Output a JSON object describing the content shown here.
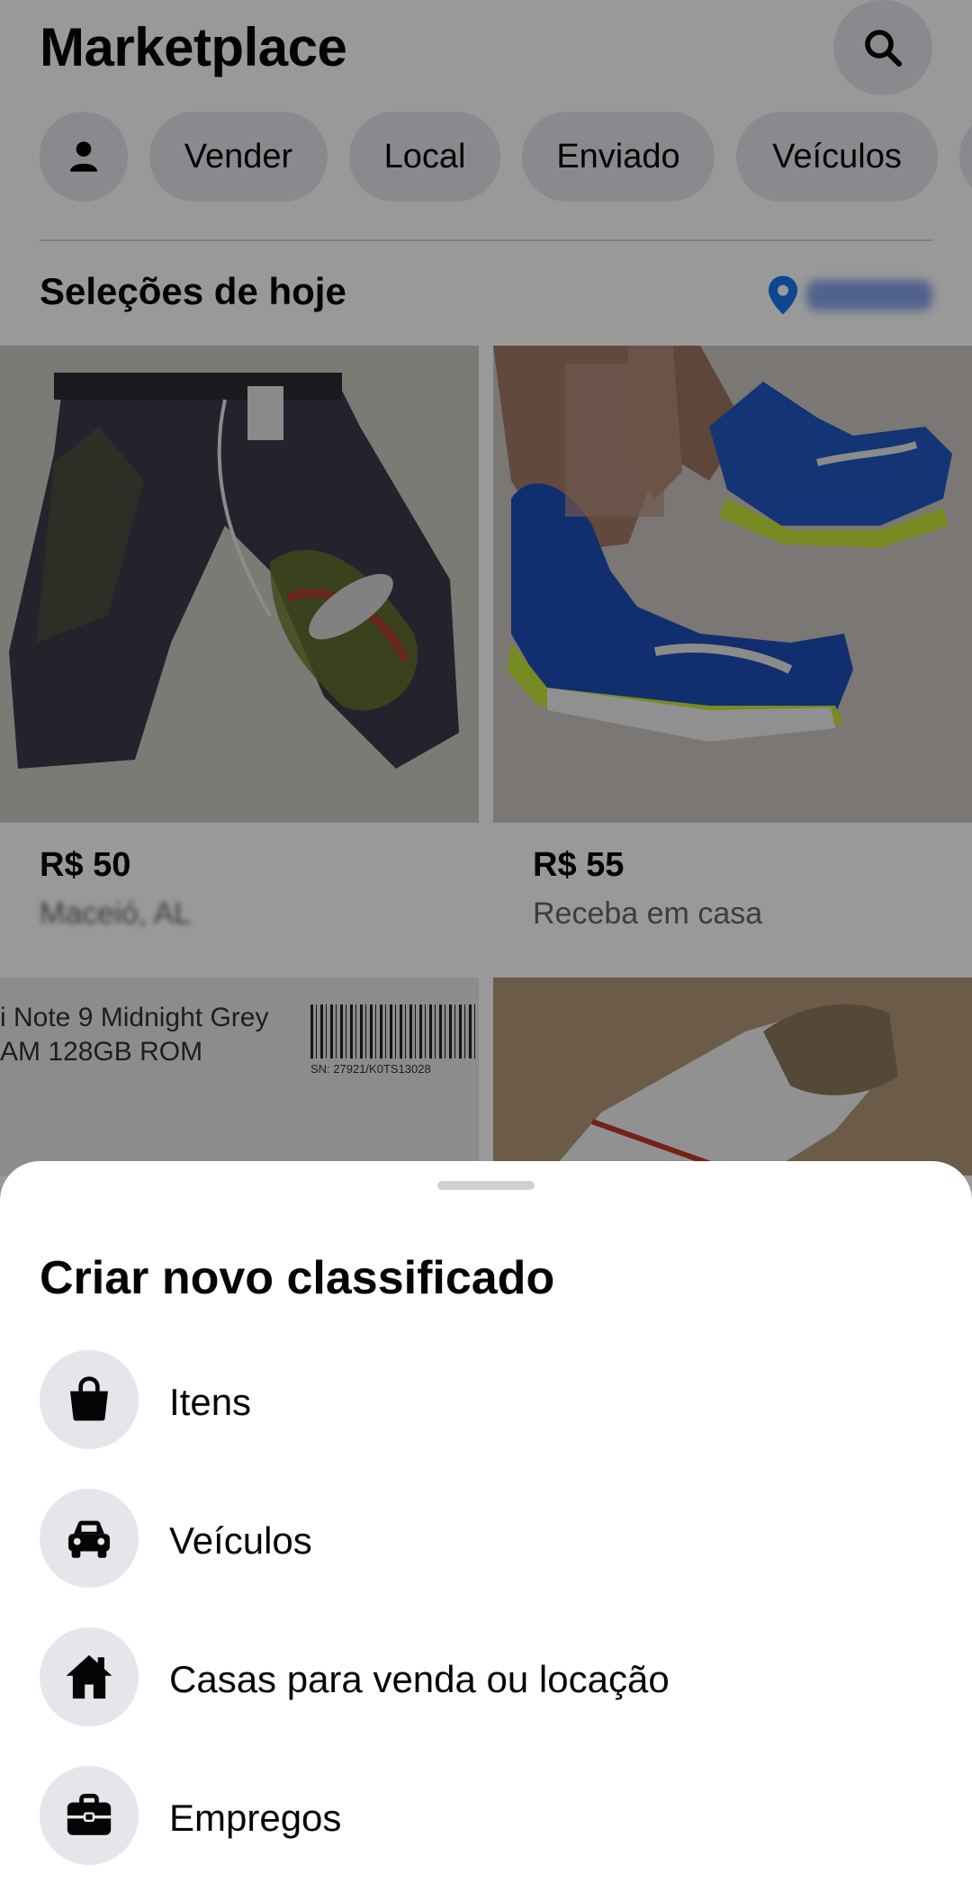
{
  "header": {
    "title": "Marketplace",
    "search_icon": "search-icon"
  },
  "chips": {
    "profile_icon": "person-icon",
    "items": [
      "Vender",
      "Local",
      "Enviado",
      "Veículos"
    ]
  },
  "section": {
    "title": "Seleções de hoje",
    "location_icon": "map-pin-icon"
  },
  "listings": [
    {
      "price": "R$ 50",
      "subtitle": "Maceió, AL",
      "subtitle_blurred": true
    },
    {
      "price": "R$ 55",
      "subtitle": "Receba em casa",
      "subtitle_blurred": false
    }
  ],
  "partial_listing": {
    "box_line_1": "i Note 9 Midnight Grey",
    "box_line_2": "AM  128GB ROM",
    "serial": "SN: 27921/K0TS13028"
  },
  "sheet": {
    "title": "Criar novo classificado",
    "options": [
      {
        "label": "Itens",
        "icon": "shopping-bag-icon"
      },
      {
        "label": "Veículos",
        "icon": "car-icon"
      },
      {
        "label": "Casas para venda ou locação",
        "icon": "house-icon"
      },
      {
        "label": "Empregos",
        "icon": "briefcase-icon"
      }
    ]
  },
  "colors": {
    "chip_bg": "#e4e6eb",
    "text_primary": "#050505",
    "text_secondary": "#65676b",
    "accent_blue": "#1877f2",
    "overlay": "rgba(0,0,0,0.40)"
  }
}
